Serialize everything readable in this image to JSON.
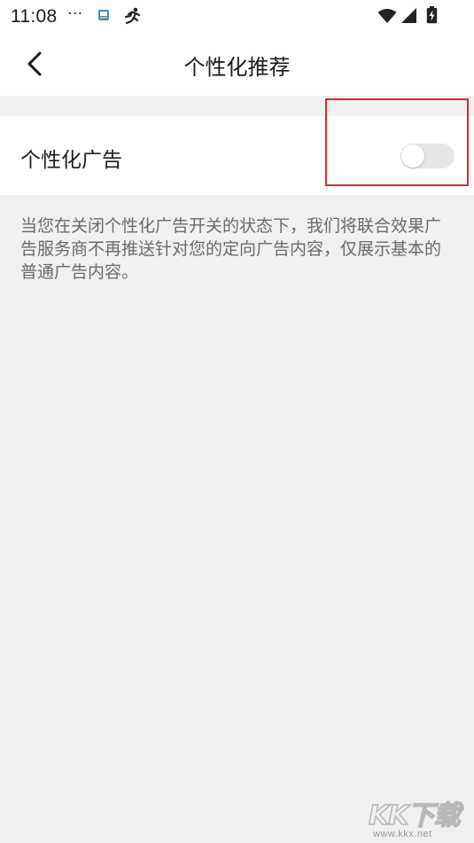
{
  "status_bar": {
    "time": "11:08",
    "dots": "···",
    "icons": [
      "app-notification-icon",
      "running-icon",
      "wifi-icon",
      "signal-icon",
      "battery-charging-icon"
    ]
  },
  "nav": {
    "back_icon": "chevron-left-icon",
    "title": "个性化推荐"
  },
  "setting": {
    "label": "个性化广告",
    "toggle_on": false
  },
  "description": "当您在关闭个性化广告开关的状态下，我们将联合效果广告服务商不再推送针对您的定向广告内容，仅展示基本的普通广告内容。",
  "watermark": {
    "logo": "KK下载",
    "url": "www.kkx.net"
  },
  "colors": {
    "page_background": "#f0f0f0",
    "card_background": "#ffffff",
    "toggle_off_track": "#e6e6e6",
    "highlight": "#e0262b",
    "description_text": "#6b6b6b"
  }
}
